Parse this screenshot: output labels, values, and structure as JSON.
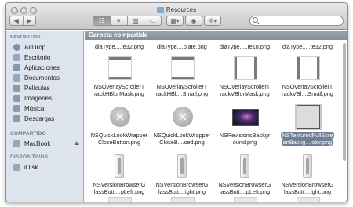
{
  "window": {
    "title": "Resources",
    "nav_back": "◀",
    "nav_forward": "▶"
  },
  "toolbar": {
    "views": [
      "☷",
      "≡",
      "▥",
      "▭"
    ],
    "arrange": "▦▾",
    "quicklook": "◉",
    "action": "✲▾",
    "search_placeholder": ""
  },
  "sidebar": {
    "favorites_header": "FAVORITOS",
    "favorites": [
      {
        "label": "AirDrop",
        "icon": "airdrop-icon",
        "color": "#7a8fa8"
      },
      {
        "label": "Escritorio",
        "icon": "desktop-icon",
        "color": "#9aa6b5"
      },
      {
        "label": "Aplicaciones",
        "icon": "applications-icon",
        "color": "#8595aa"
      },
      {
        "label": "Documentos",
        "icon": "documents-icon",
        "color": "#9ba7b6"
      },
      {
        "label": "Películas",
        "icon": "movies-icon",
        "color": "#8e9aab"
      },
      {
        "label": "Imágenes",
        "icon": "pictures-icon",
        "color": "#8e9aab"
      },
      {
        "label": "Música",
        "icon": "music-icon",
        "color": "#8e9aab"
      },
      {
        "label": "Descargas",
        "icon": "downloads-icon",
        "color": "#8e9aab"
      }
    ],
    "shared_header": "COMPARTIDO",
    "shared": [
      {
        "label": "MacBook",
        "icon": "computer-icon",
        "color": "#9aa6b5",
        "eject": "⏏"
      }
    ],
    "devices_header": "DISPOSITIVOS",
    "devices": [
      {
        "label": "iDisk",
        "icon": "idisk-icon",
        "color": "#9aa6b5"
      }
    ]
  },
  "content": {
    "path_label": "Carpeta compartida",
    "row0": [
      "diaType....te32.png",
      "diaType....plate.png",
      "diaType.....te18.png",
      "diaType.....te32.png"
    ],
    "row1": [
      [
        "NSOverlayScrollerT",
        "rackHBlurMask.png"
      ],
      [
        "NSOverlayScrollerT",
        "rackHBl....Small.png"
      ],
      [
        "NSOverlayScrollerT",
        "rackVBlurMask.png"
      ],
      [
        "NSOverlayScrollerT",
        "rackVBl....Small.png"
      ]
    ],
    "row2": [
      [
        "NSQuickLookWrapper",
        "CloseButton.png"
      ],
      [
        "NSQuickLookWrapper",
        "CloseB....sed.png"
      ],
      [
        "NSRevisionsBackgr",
        "ound.png"
      ],
      [
        "NSTexturedFullScre",
        "enBackg....olor.png"
      ]
    ],
    "row3": [
      [
        "NSVersionBrowserG",
        "lassButt....pLeft.png"
      ],
      [
        "NSVersionBrowserG",
        "lassButt....ight.png"
      ],
      [
        "NSVersionBrowserG",
        "lassButt....pLeft.png"
      ],
      [
        "NSVersionBrowserG",
        "lassButt....ight.png"
      ]
    ]
  },
  "colors": {
    "sidebar_bg": "#dde4ed",
    "selection": "#6f7f95"
  }
}
